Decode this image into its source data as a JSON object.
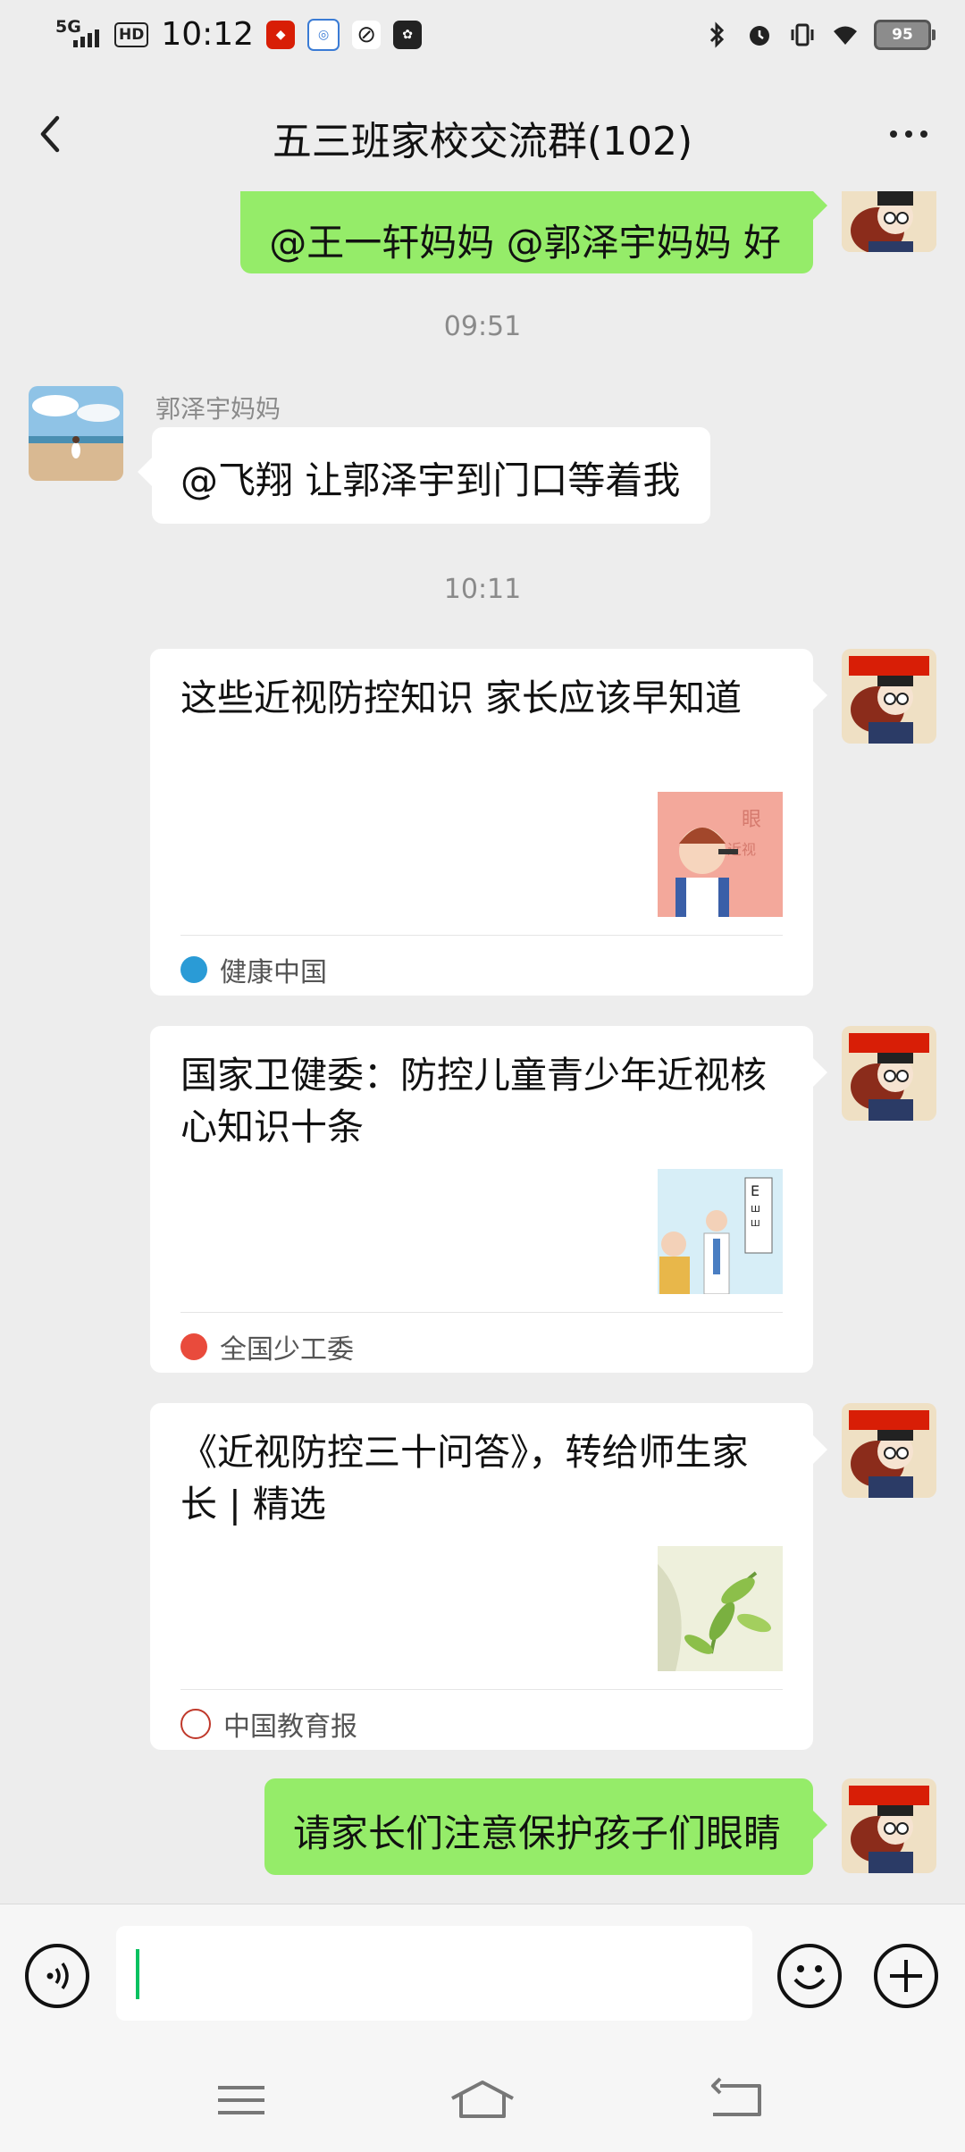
{
  "status_bar": {
    "network": "5G",
    "hd": "HD",
    "time": "10:12",
    "battery": "95"
  },
  "header": {
    "title": "五三班家校交流群(102)"
  },
  "messages": {
    "msg1": {
      "text": "@王一轩妈妈  @郭泽宇妈妈   好"
    },
    "time1": "09:51",
    "msg2": {
      "sender": "郭泽宇妈妈",
      "text": "@飞翔   让郭泽宇到门口等着我"
    },
    "time2": "10:11",
    "cards": [
      {
        "title": "这些近视防控知识 家长应该早知道",
        "source": "健康中国",
        "thumb_text": "眼 近视 预 防"
      },
      {
        "title": "国家卫健委：防控儿童青少年近视核心知识十条",
        "source": "全国少工委"
      },
      {
        "title": "《近视防控三十问答》，转给师生家长 | 精选",
        "source": "中国教育报"
      }
    ],
    "msg_last": {
      "text": "请家长们注意保护孩子们眼睛"
    }
  },
  "input_bar": {
    "placeholder": ""
  },
  "colors": {
    "self_bubble": "#95ec69",
    "background": "#ededed",
    "caret": "#07c160"
  },
  "icons": [
    "back-icon",
    "more-icon",
    "voice-icon",
    "emoji-icon",
    "plus-icon",
    "menu-icon",
    "home-icon",
    "return-icon"
  ]
}
